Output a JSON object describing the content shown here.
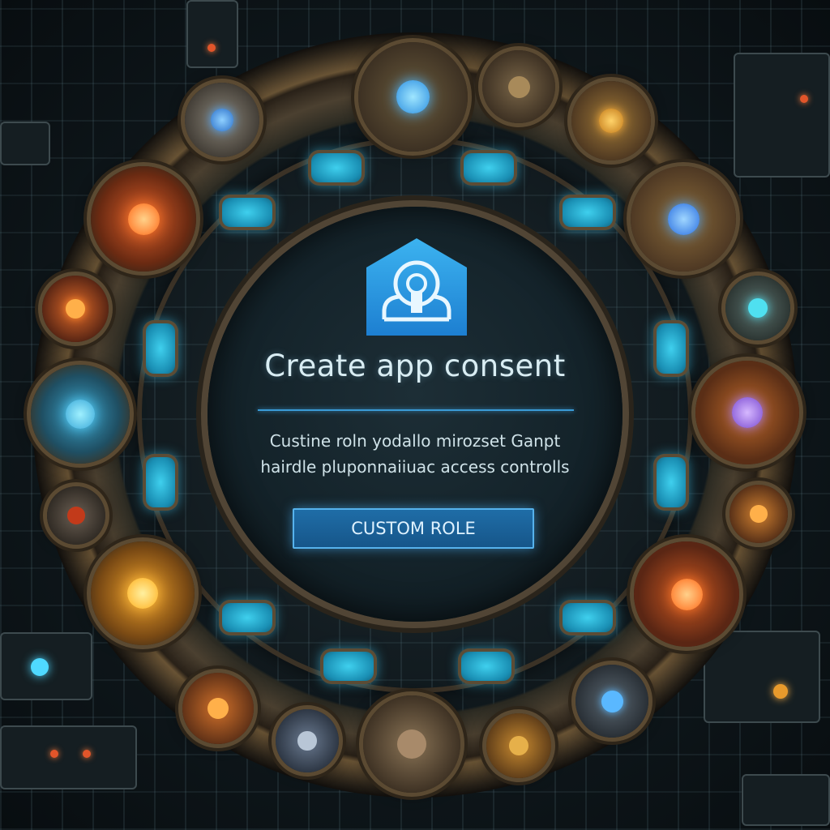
{
  "dialog": {
    "title": "Create app consent",
    "description_line1": "Custine roln yodallo mirozset Ganpt",
    "description_line2": "hairdle pluponnaiiuac access controlls",
    "button_label": "CUSTOM ROLE"
  },
  "icons": {
    "dialog_icon": "lock-icon"
  },
  "colors": {
    "accent": "#3a9bd6",
    "button_bg": "#1d659c",
    "title_text": "#d9edf3"
  }
}
